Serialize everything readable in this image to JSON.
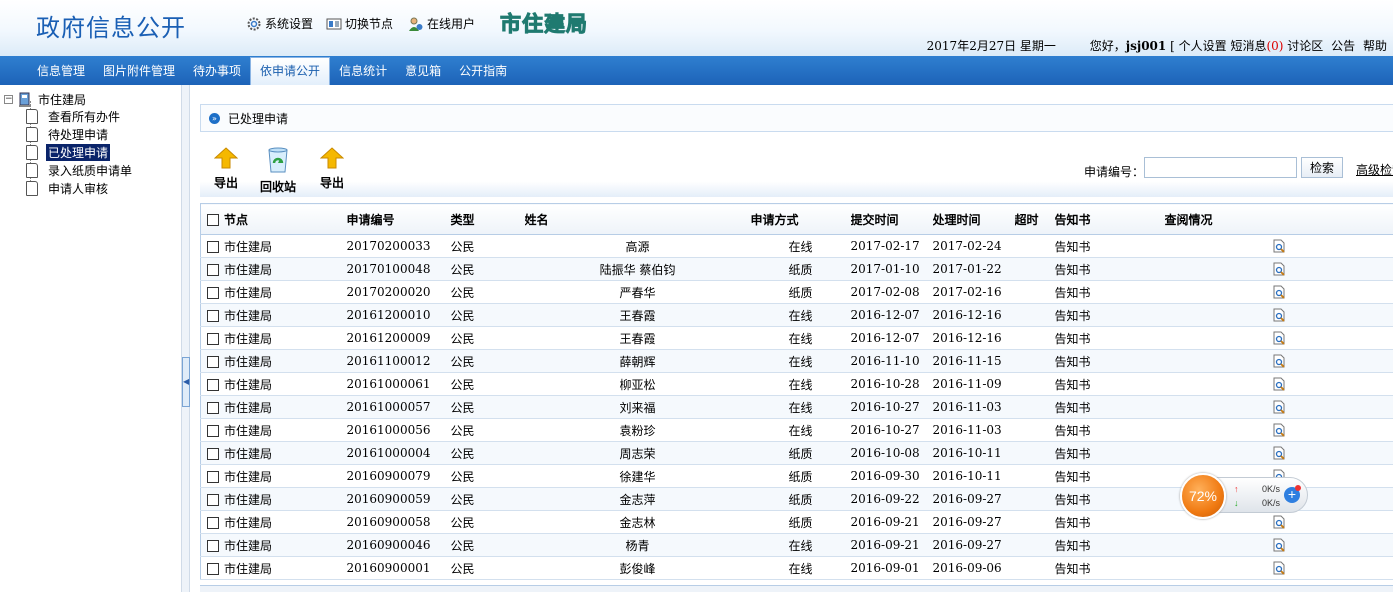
{
  "header": {
    "app_title": "政府信息公开",
    "tools": [
      {
        "label": "系统设置",
        "icon": "gear-icon"
      },
      {
        "label": "切换节点",
        "icon": "switch-icon"
      },
      {
        "label": "在线用户",
        "icon": "users-icon"
      }
    ],
    "org_logo": "市住建局",
    "date": "2017年2月27日 星期一",
    "greeting": "您好，",
    "username": "jsj001",
    "bracket_open": "[",
    "links": [
      "个人设置",
      "短消息",
      "讨论区",
      "公告",
      "帮助"
    ],
    "unread_count": "(0)"
  },
  "nav": {
    "items": [
      "信息管理",
      "图片附件管理",
      "待办事项",
      "依申请公开",
      "信息统计",
      "意见箱",
      "公开指南"
    ],
    "active_index": 3
  },
  "tree": {
    "root": "市住建局",
    "toggle": "−",
    "items": [
      "查看所有办件",
      "待处理申请",
      "已处理申请",
      "录入纸质申请单",
      "申请人审核"
    ],
    "selected_index": 2
  },
  "main": {
    "breadcrumb": "已处理申请",
    "toolbar": {
      "export1": "导出",
      "recycle": "回收站",
      "export2": "导出"
    },
    "search": {
      "label": "申请编号：",
      "value": "",
      "button": "检索",
      "advanced": "高级检索"
    }
  },
  "table": {
    "headers": [
      "节点",
      "申请编号",
      "类型",
      "姓名",
      "申请方式",
      "提交时间",
      "处理时间",
      "超时",
      "告知书",
      "查阅情况"
    ],
    "rows": [
      [
        "市住建局",
        "20170200033",
        "公民",
        "高源",
        "在线",
        "2017-02-17",
        "2017-02-24",
        "",
        "告知书"
      ],
      [
        "市住建局",
        "20170100048",
        "公民",
        "陆振华 蔡伯钧",
        "纸质",
        "2017-01-10",
        "2017-01-22",
        "",
        "告知书"
      ],
      [
        "市住建局",
        "20170200020",
        "公民",
        "严春华",
        "纸质",
        "2017-02-08",
        "2017-02-16",
        "",
        "告知书"
      ],
      [
        "市住建局",
        "20161200010",
        "公民",
        "王春霞",
        "在线",
        "2016-12-07",
        "2016-12-16",
        "",
        "告知书"
      ],
      [
        "市住建局",
        "20161200009",
        "公民",
        "王春霞",
        "在线",
        "2016-12-07",
        "2016-12-16",
        "",
        "告知书"
      ],
      [
        "市住建局",
        "20161100012",
        "公民",
        "薛朝辉",
        "在线",
        "2016-11-10",
        "2016-11-15",
        "",
        "告知书"
      ],
      [
        "市住建局",
        "20161000061",
        "公民",
        "柳亚松",
        "在线",
        "2016-10-28",
        "2016-11-09",
        "",
        "告知书"
      ],
      [
        "市住建局",
        "20161000057",
        "公民",
        "刘来福",
        "在线",
        "2016-10-27",
        "2016-11-03",
        "",
        "告知书"
      ],
      [
        "市住建局",
        "20161000056",
        "公民",
        "袁粉珍",
        "在线",
        "2016-10-27",
        "2016-11-03",
        "",
        "告知书"
      ],
      [
        "市住建局",
        "20161000004",
        "公民",
        "周志荣",
        "纸质",
        "2016-10-08",
        "2016-10-11",
        "",
        "告知书"
      ],
      [
        "市住建局",
        "20160900079",
        "公民",
        "徐建华",
        "纸质",
        "2016-09-30",
        "2016-10-11",
        "",
        "告知书"
      ],
      [
        "市住建局",
        "20160900059",
        "公民",
        "金志萍",
        "纸质",
        "2016-09-22",
        "2016-09-27",
        "",
        "告知书"
      ],
      [
        "市住建局",
        "20160900058",
        "公民",
        "金志林",
        "纸质",
        "2016-09-21",
        "2016-09-27",
        "",
        "告知书"
      ],
      [
        "市住建局",
        "20160900046",
        "公民",
        "杨青",
        "在线",
        "2016-09-21",
        "2016-09-27",
        "",
        "告知书"
      ],
      [
        "市住建局",
        "20160900001",
        "公民",
        "彭俊峰",
        "在线",
        "2016-09-01",
        "2016-09-06",
        "",
        "告知书"
      ]
    ]
  },
  "net_widget": {
    "percent": "72%",
    "up": "0K/s",
    "down": "0K/s"
  },
  "colors": {
    "nav_bg": "#1d63b8",
    "title": "#1a5fb4",
    "selected_tree": "#0a246a"
  }
}
